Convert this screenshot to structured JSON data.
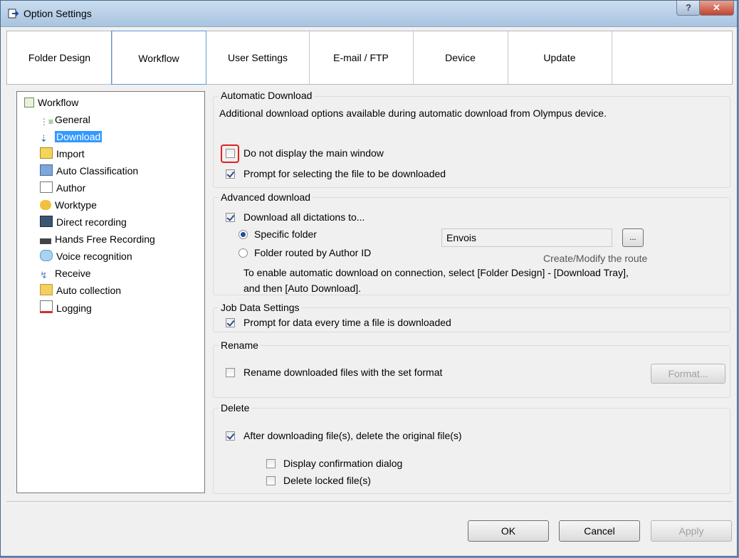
{
  "window": {
    "title": "Option Settings"
  },
  "tabs": [
    {
      "label": "Folder Design"
    },
    {
      "label": "Workflow"
    },
    {
      "label": "User Settings"
    },
    {
      "label": "E-mail / FTP"
    },
    {
      "label": "Device"
    },
    {
      "label": "Update"
    }
  ],
  "tree": {
    "root": "Workflow",
    "items": [
      {
        "label": "General",
        "icon": "list-icon"
      },
      {
        "label": "Download",
        "icon": "download-icon"
      },
      {
        "label": "Import",
        "icon": "import-icon"
      },
      {
        "label": "Auto Classification",
        "icon": "classification-icon"
      },
      {
        "label": "Author",
        "icon": "author-icon"
      },
      {
        "label": "Worktype",
        "icon": "worktype-icon"
      },
      {
        "label": "Direct recording",
        "icon": "recording-icon"
      },
      {
        "label": "Hands Free Recording",
        "icon": "handsfree-icon"
      },
      {
        "label": "Voice recognition",
        "icon": "speech-bubble-icon"
      },
      {
        "label": "Receive",
        "icon": "receive-icon"
      },
      {
        "label": "Auto collection",
        "icon": "folder-icon"
      },
      {
        "label": "Logging",
        "icon": "log-icon"
      }
    ]
  },
  "automatic_download": {
    "title": "Automatic Download",
    "description": "Additional download options available during automatic download from Olympus device.",
    "opt_no_main_window": "Do not display the main window",
    "opt_prompt_file": "Prompt for selecting the file to be downloaded"
  },
  "advanced_download": {
    "title": "Advanced download",
    "opt_download_all": "Download all dictations to...",
    "radio_specific": "Specific folder",
    "radio_author": "Folder routed by Author ID",
    "folder_value": "Envois",
    "browse_label": "...",
    "route_label": "Create/Modify the route",
    "note_line1": "To enable automatic download on connection, select [Folder Design] - [Download Tray],",
    "note_line2": "and then [Auto Download]."
  },
  "job_data": {
    "title": "Job Data Settings",
    "opt_prompt_data": "Prompt for data every time a file is downloaded"
  },
  "rename": {
    "title": "Rename",
    "opt_rename": "Rename downloaded files with the set format",
    "format_button": "Format..."
  },
  "delete": {
    "title": "Delete",
    "opt_delete_original": "After downloading file(s), delete the original file(s)",
    "opt_confirm": "Display confirmation dialog",
    "opt_locked": "Delete locked file(s)"
  },
  "footer": {
    "ok": "OK",
    "cancel": "Cancel",
    "apply": "Apply"
  }
}
